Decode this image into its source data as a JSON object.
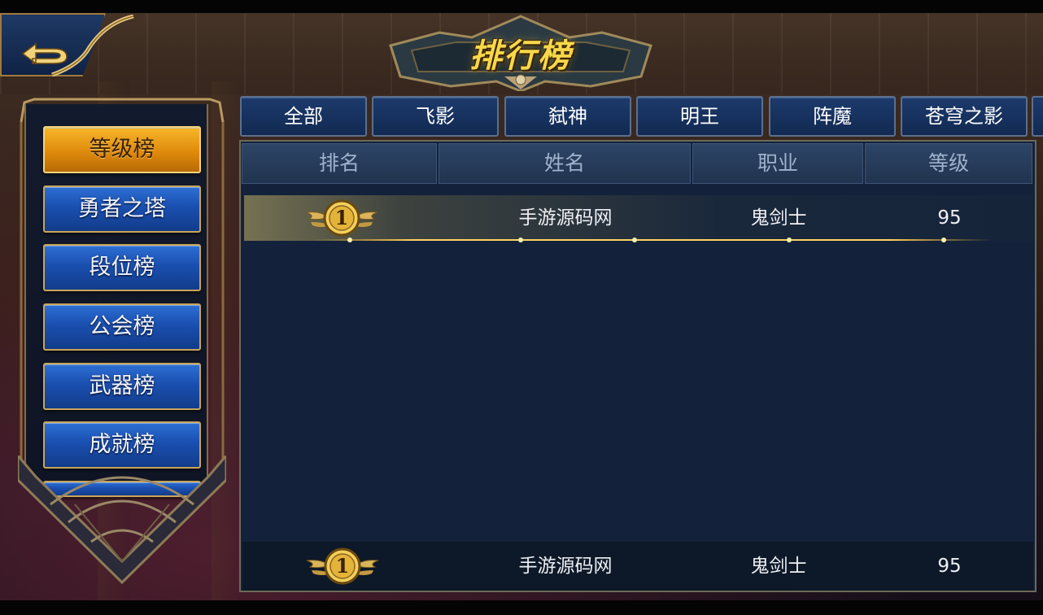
{
  "header": {
    "title": "排行榜"
  },
  "sidebar": {
    "items": [
      {
        "label": "等级榜",
        "active": true
      },
      {
        "label": "勇者之塔",
        "active": false
      },
      {
        "label": "段位榜",
        "active": false
      },
      {
        "label": "公会榜",
        "active": false
      },
      {
        "label": "武器榜",
        "active": false
      },
      {
        "label": "成就榜",
        "active": false
      }
    ]
  },
  "tabs": [
    {
      "label": "全部"
    },
    {
      "label": "飞影"
    },
    {
      "label": "弑神"
    },
    {
      "label": "明王"
    },
    {
      "label": "阵魔"
    },
    {
      "label": "苍穹之影"
    }
  ],
  "table": {
    "columns": [
      "排名",
      "姓名",
      "职业",
      "等级"
    ],
    "rows": [
      {
        "rank": "1",
        "name": "手游源码网",
        "class": "鬼剑士",
        "level": "95"
      }
    ]
  },
  "my_rank": {
    "rank": "1",
    "name": "手游源码网",
    "class": "鬼剑士",
    "level": "95"
  },
  "colors": {
    "active_tab": "#e08b0c",
    "button_blue": "#1a4fb0",
    "gold_border": "#c9a55a",
    "title_gold": "#f5d94a",
    "panel_bg": "#13223a"
  },
  "icons": {
    "back": "back-arrow-icon",
    "rank_medal": "winged-gold-medal-icon"
  }
}
